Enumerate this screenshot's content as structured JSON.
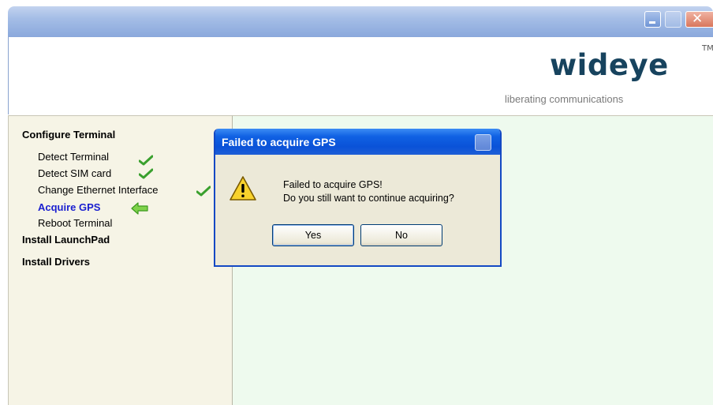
{
  "window": {
    "brand_name": "wideye",
    "trademark": "TM",
    "tagline": "liberating communications",
    "colors": {
      "brand": "#17435e",
      "sidebar_bg": "#f6f4e6",
      "content_bg": "#eefaee"
    }
  },
  "sidebar": {
    "sections": [
      {
        "label": "Configure Terminal",
        "items": [
          {
            "label": "Detect Terminal",
            "status": "done"
          },
          {
            "label": "Detect SIM card",
            "status": "done"
          },
          {
            "label": "Change Ethernet Interface",
            "status": "done"
          },
          {
            "label": "Acquire GPS",
            "status": "current"
          },
          {
            "label": "Reboot Terminal",
            "status": "pending"
          }
        ]
      },
      {
        "label": "Install LaunchPad"
      },
      {
        "label": "Install Drivers"
      }
    ]
  },
  "dialog": {
    "title": "Failed to acquire GPS",
    "icon": "warning-icon",
    "message_line1": "Failed to acquire GPS!",
    "message_line2": "Do you still want to continue acquiring?",
    "yes_label": "Yes",
    "no_label": "No"
  }
}
